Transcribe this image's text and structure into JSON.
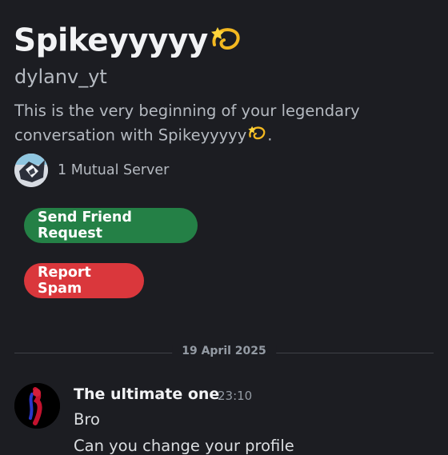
{
  "profile": {
    "display_name": "Spikeyyyyy",
    "emoji": "dizzy-icon",
    "username": "dylanv_yt",
    "intro_prefix": "This is the very beginning of your legendary conversation with ",
    "intro_name": "Spikeyyyyy",
    "intro_suffix": "."
  },
  "mutual": {
    "label": "1 Mutual Server"
  },
  "actions": {
    "send_friend_request": "Send Friend Request",
    "report_spam": "Report Spam"
  },
  "divider": {
    "date": "19 April 2025"
  },
  "messages": [
    {
      "author": "The ultimate one",
      "time": "23:10",
      "lines": [
        "Bro",
        "Can you change your profile"
      ]
    }
  ],
  "colors": {
    "background": "#1c1d22",
    "friend_button": "#248046",
    "spam_button": "#da373c",
    "muted_text": "#b5bac1"
  }
}
